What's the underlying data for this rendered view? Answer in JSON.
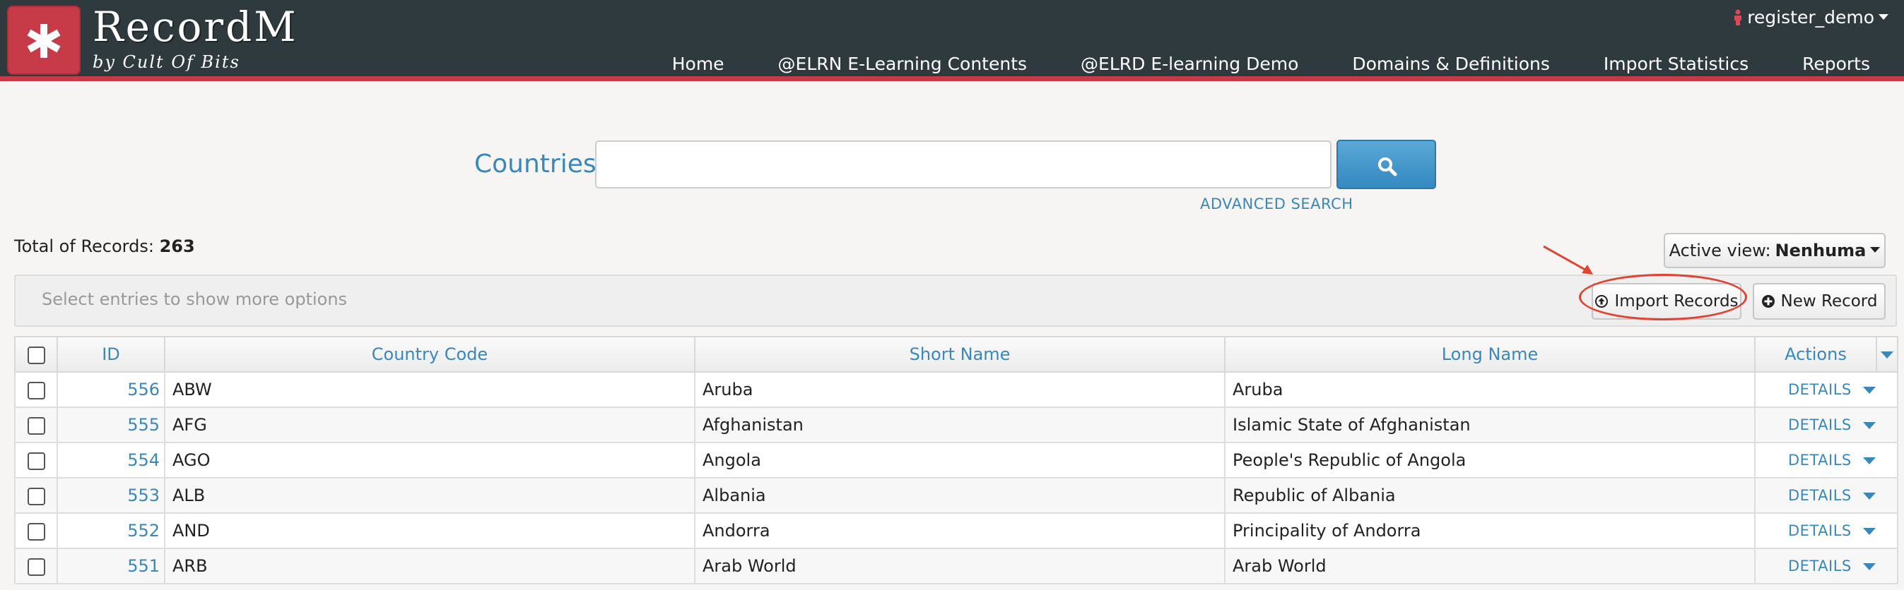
{
  "brand": {
    "name": "RecordM",
    "subtitle": "by Cult Of Bits"
  },
  "user": {
    "name": "register_demo"
  },
  "nav": {
    "items": [
      {
        "label": "Home"
      },
      {
        "label": "@ELRN E-Learning Contents"
      },
      {
        "label": "@ELRD E-learning Demo"
      },
      {
        "label": "Domains & Definitions"
      },
      {
        "label": "Import Statistics"
      },
      {
        "label": "Reports"
      }
    ]
  },
  "search": {
    "label": "Countries",
    "value": "",
    "placeholder": "",
    "advanced_label": "ADVANCED SEARCH"
  },
  "records": {
    "total_label": "Total of Records:",
    "total_count": "263"
  },
  "view": {
    "label": "Active view:",
    "value": "Nenhuma"
  },
  "options_bar": {
    "hint": "Select entries to show more options",
    "import_label": "Import Records",
    "new_label": "New Record"
  },
  "table": {
    "headers": {
      "id": "ID",
      "country_code": "Country Code",
      "short_name": "Short Name",
      "long_name": "Long Name",
      "actions": "Actions"
    },
    "rows": [
      {
        "id": "556",
        "code": "ABW",
        "short": "Aruba",
        "long": "Aruba",
        "action": "DETAILS"
      },
      {
        "id": "555",
        "code": "AFG",
        "short": "Afghanistan",
        "long": "Islamic State of Afghanistan",
        "action": "DETAILS"
      },
      {
        "id": "554",
        "code": "AGO",
        "short": "Angola",
        "long": "People's Republic of Angola",
        "action": "DETAILS"
      },
      {
        "id": "553",
        "code": "ALB",
        "short": "Albania",
        "long": "Republic of Albania",
        "action": "DETAILS"
      },
      {
        "id": "552",
        "code": "AND",
        "short": "Andorra",
        "long": "Principality of Andorra",
        "action": "DETAILS"
      },
      {
        "id": "551",
        "code": "ARB",
        "short": "Arab World",
        "long": "Arab World",
        "action": "DETAILS"
      }
    ]
  },
  "colors": {
    "topbar": "#2f3a3f",
    "brand_red": "#c73a47",
    "link_blue": "#3a87ba",
    "annotation_red": "#e0432f"
  },
  "icons": {
    "logo": "asterisk-icon",
    "user": "person-icon",
    "search": "magnifier-icon",
    "import": "circle-arrow-up-icon",
    "new": "circle-plus-icon"
  }
}
